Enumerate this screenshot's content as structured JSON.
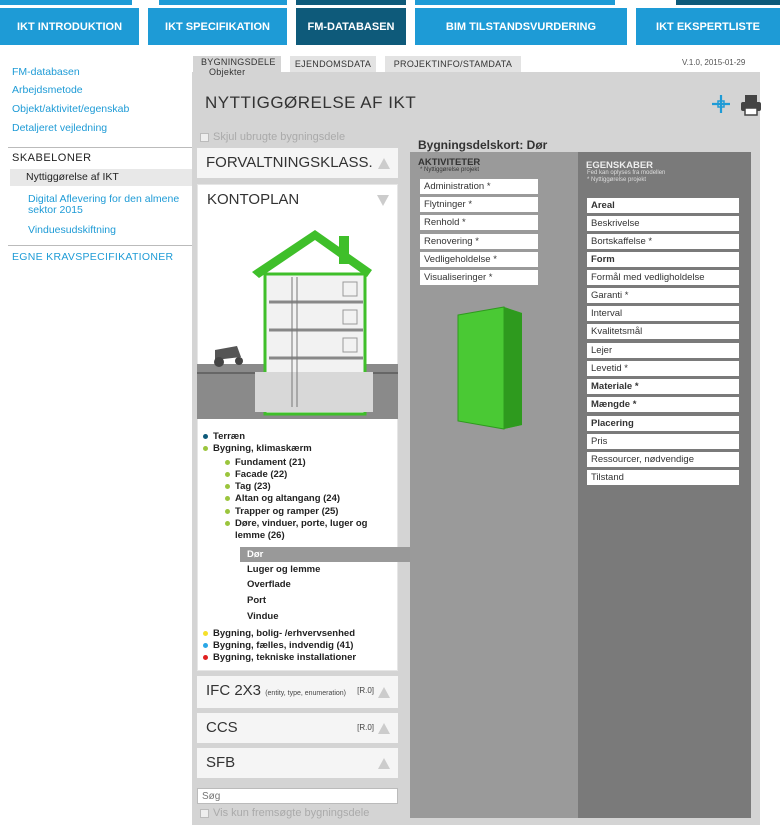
{
  "nav": {
    "tabs": [
      "IKT INTRODUKTION",
      "IKT SPECIFIKATION",
      "FM-DATABASEN",
      "BIM TILSTANDSVURDERING",
      "IKT EKSPERTLISTE"
    ]
  },
  "version": "V.1.0, 2015-01-29",
  "sidebar": {
    "links": [
      "FM-databasen",
      "Arbejdsmetode",
      "Objekt/aktivitet/egenskab",
      "Detaljeret vejledning"
    ],
    "skabeloner_title": "SKABELONER",
    "templates": [
      "Nyttiggørelse af IKT",
      "Digital Aflevering for den almene",
      "sektor 2015",
      "Vinduesudskiftning"
    ],
    "egne": "EGNE KRAVSPECIFIKATIONER"
  },
  "subtabs": {
    "bygningsdele": "BYGNINGSDELE",
    "objekter": "Objekter",
    "ejendomsdata": "EJENDOMSDATA",
    "projektinfo": "PROJEKTINFO/STAMDATA"
  },
  "page_title": "NYTTIGGØRELSE AF IKT",
  "skjul_label": "Skjul ubrugte bygningsdele",
  "sections": {
    "forvaltning": "FORVALTNINGSKLASS.",
    "kontoplan": "KONTOPLAN",
    "ifc": "IFC 2X3",
    "ifc_sub": "(entity, type, enumeration)",
    "ifc_badge": "[R.0]",
    "ccs": "CCS",
    "ccs_badge": "[R.0]",
    "sfb": "SFB"
  },
  "tree": {
    "terraen": "Terræn",
    "bygning": "Bygning, klimaskærm",
    "children": [
      "Fundament (21)",
      "Facade (22)",
      "Tag (23)",
      "Altan og altangang (24)",
      "Trapper og ramper (25)",
      "Døre, vinduer, porte, luger og",
      "lemme (26)"
    ],
    "leaves": [
      "Dør",
      "Luger og lemme",
      "Overflade",
      "Port",
      "Vindue"
    ],
    "others": [
      "Bygning, bolig- /erhvervsenhed",
      "Bygning, fælles, indvendig (41)",
      "Bygning, tekniske installationer"
    ]
  },
  "search": {
    "placeholder": "Søg",
    "vis_label": "Vis kun fremsøgte bygningsdele"
  },
  "card": {
    "title": "Bygningsdelskort: Dør",
    "aktiviteter": "AKTIVITETER",
    "akt_sub": "* Nyttiggørelse projekt",
    "activities": [
      "Administration *",
      "Flytninger *",
      "Renhold *",
      "Renovering *",
      "Vedligeholdelse *",
      "Visualiseringer *"
    ],
    "egenskaber": "EGENSKABER",
    "eg_sub1": "Fed kan oplyses fra modellen",
    "eg_sub2": "* Nyttiggørelse projekt",
    "properties": [
      "Areal",
      "Beskrivelse",
      "Bortskaffelse *",
      "Form",
      "Formål med vedligholdelse",
      "Garanti *",
      "Interval",
      "Kvalitetsmål",
      "Lejer",
      "Levetid *",
      "Materiale *",
      "Mængde *",
      "Placering",
      "Pris",
      "Ressourcer, nødvendige",
      "Tilstand"
    ]
  },
  "colors": {
    "accent": "#1e9bd6",
    "active": "#0e5a7a",
    "green": "#3fbf2a"
  }
}
